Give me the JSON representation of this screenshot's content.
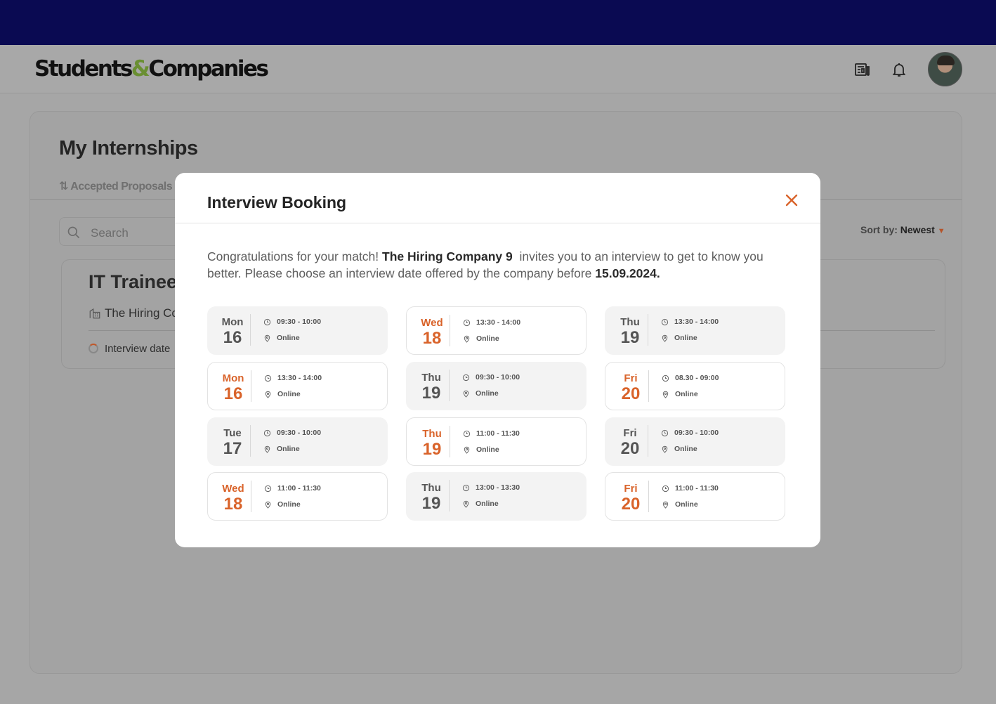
{
  "header": {
    "logo_part1": "Students",
    "logo_amp": "&",
    "logo_part2": "Companies",
    "icons": [
      "news-icon",
      "bell-icon",
      "avatar"
    ]
  },
  "background_page": {
    "title": "My Internships",
    "tab": "Accepted Proposals",
    "search_placeholder": "Search",
    "sort_label": "Sort by:",
    "sort_value": "Newest",
    "internship": {
      "title": "IT Trainee",
      "company": "The Hiring Co",
      "status": "Interview date"
    }
  },
  "modal": {
    "title": "Interview Booking",
    "text_1": "Congratulations for your match!",
    "company": "The Hiring Company 9",
    "text_2": "invites you to an interview to get to know you better. Please choose an interview date offered by the company before",
    "deadline": "15.09.2024.",
    "columns": [
      [
        {
          "day": "Mon",
          "date": "16",
          "time": "09:30 - 10:00",
          "location": "Online",
          "highlight": false
        },
        {
          "day": "Mon",
          "date": "16",
          "time": "13:30 - 14:00",
          "location": "Online",
          "highlight": true
        },
        {
          "day": "Tue",
          "date": "17",
          "time": "09:30 - 10:00",
          "location": "Online",
          "highlight": false
        },
        {
          "day": "Wed",
          "date": "18",
          "time": "11:00 - 11:30",
          "location": "Online",
          "highlight": true
        }
      ],
      [
        {
          "day": "Wed",
          "date": "18",
          "time": "13:30 - 14:00",
          "location": "Online",
          "highlight": true
        },
        {
          "day": "Thu",
          "date": "19",
          "time": "09:30 - 10:00",
          "location": "Online",
          "highlight": false
        },
        {
          "day": "Thu",
          "date": "19",
          "time": "11:00 - 11:30",
          "location": "Online",
          "highlight": true
        },
        {
          "day": "Thu",
          "date": "19",
          "time": "13:00 - 13:30",
          "location": "Online",
          "highlight": false
        }
      ],
      [
        {
          "day": "Thu",
          "date": "19",
          "time": "13:30 - 14:00",
          "location": "Online",
          "highlight": false
        },
        {
          "day": "Fri",
          "date": "20",
          "time": "08.30 - 09:00",
          "location": "Online",
          "highlight": true
        },
        {
          "day": "Fri",
          "date": "20",
          "time": "09:30 - 10:00",
          "location": "Online",
          "highlight": false
        },
        {
          "day": "Fri",
          "date": "20",
          "time": "11:00 - 11:30",
          "location": "Online",
          "highlight": true
        }
      ]
    ],
    "accent_color": "#d9632a"
  }
}
